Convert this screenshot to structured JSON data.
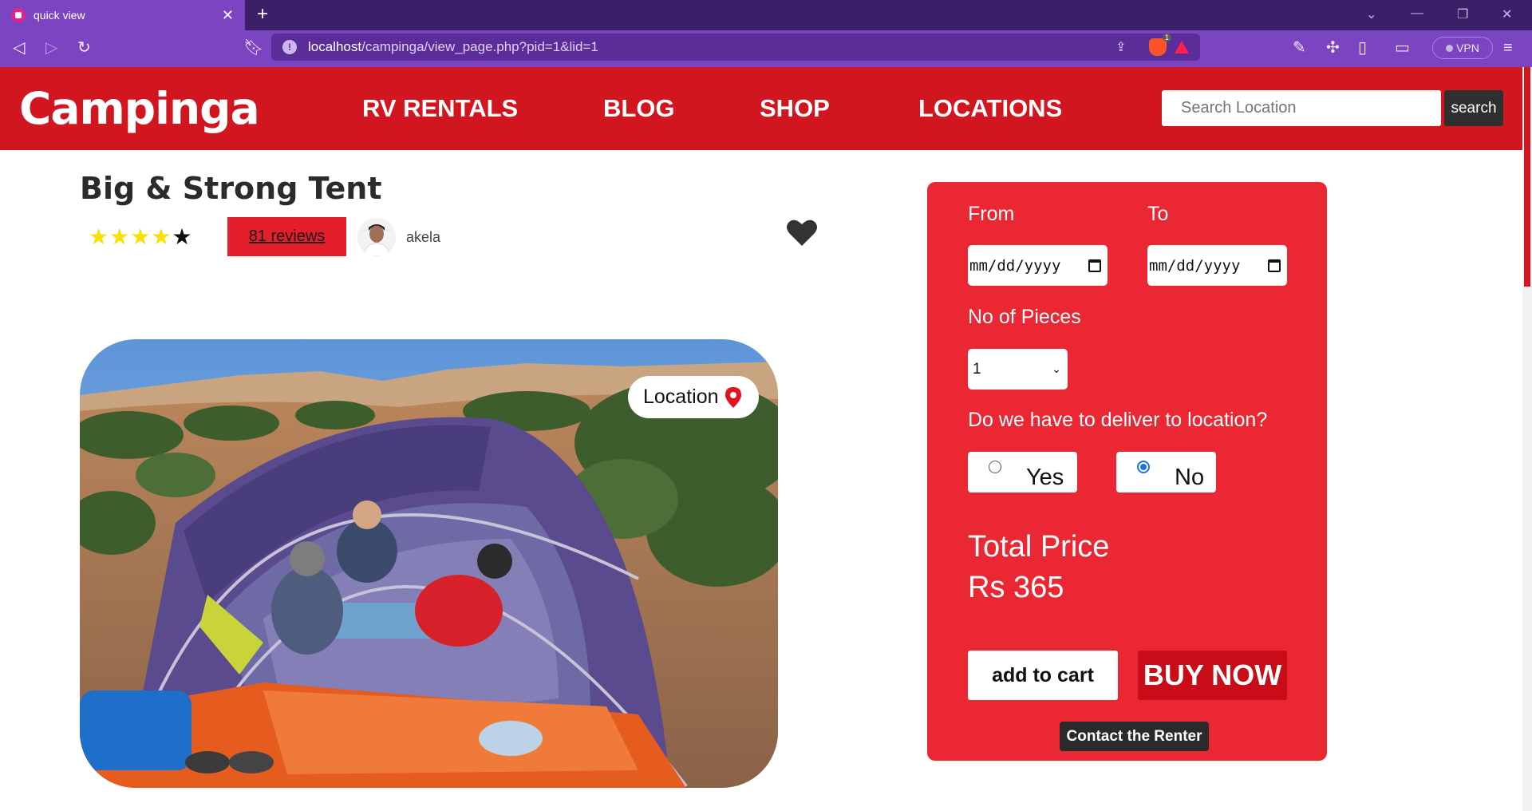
{
  "browser": {
    "tab_title": "quick view",
    "url_host": "localhost",
    "url_path": "/campinga/view_page.php?pid=1&lid=1",
    "vpn_label": "VPN",
    "shield_count": "1"
  },
  "site": {
    "logo": "Campinga",
    "menu": [
      "RV RENTALS",
      "BLOG",
      "SHOP",
      "LOCATIONS"
    ],
    "search_placeholder": "Search Location",
    "search_button": "search",
    "brand_color": "#d2161f"
  },
  "product": {
    "title": "Big & Strong Tent",
    "rating": 4,
    "rating_max": 5,
    "reviews_label": "81 reviews",
    "owner_name": "akela",
    "location_label": "Location"
  },
  "booking": {
    "from_label": "From",
    "to_label": "To",
    "date_placeholder": "mm/dd/yyyy",
    "pieces_label": "No of Pieces",
    "pieces_value": "1",
    "deliver_question": "Do we have to deliver to location?",
    "option_yes": "Yes",
    "option_no": "No",
    "selected_option": "No",
    "total_label": "Total Price",
    "total_value": "Rs 365",
    "add_to_cart": "add to cart",
    "buy_now": "BUY NOW",
    "contact": "Contact the Renter",
    "card_color": "#ea2733"
  }
}
